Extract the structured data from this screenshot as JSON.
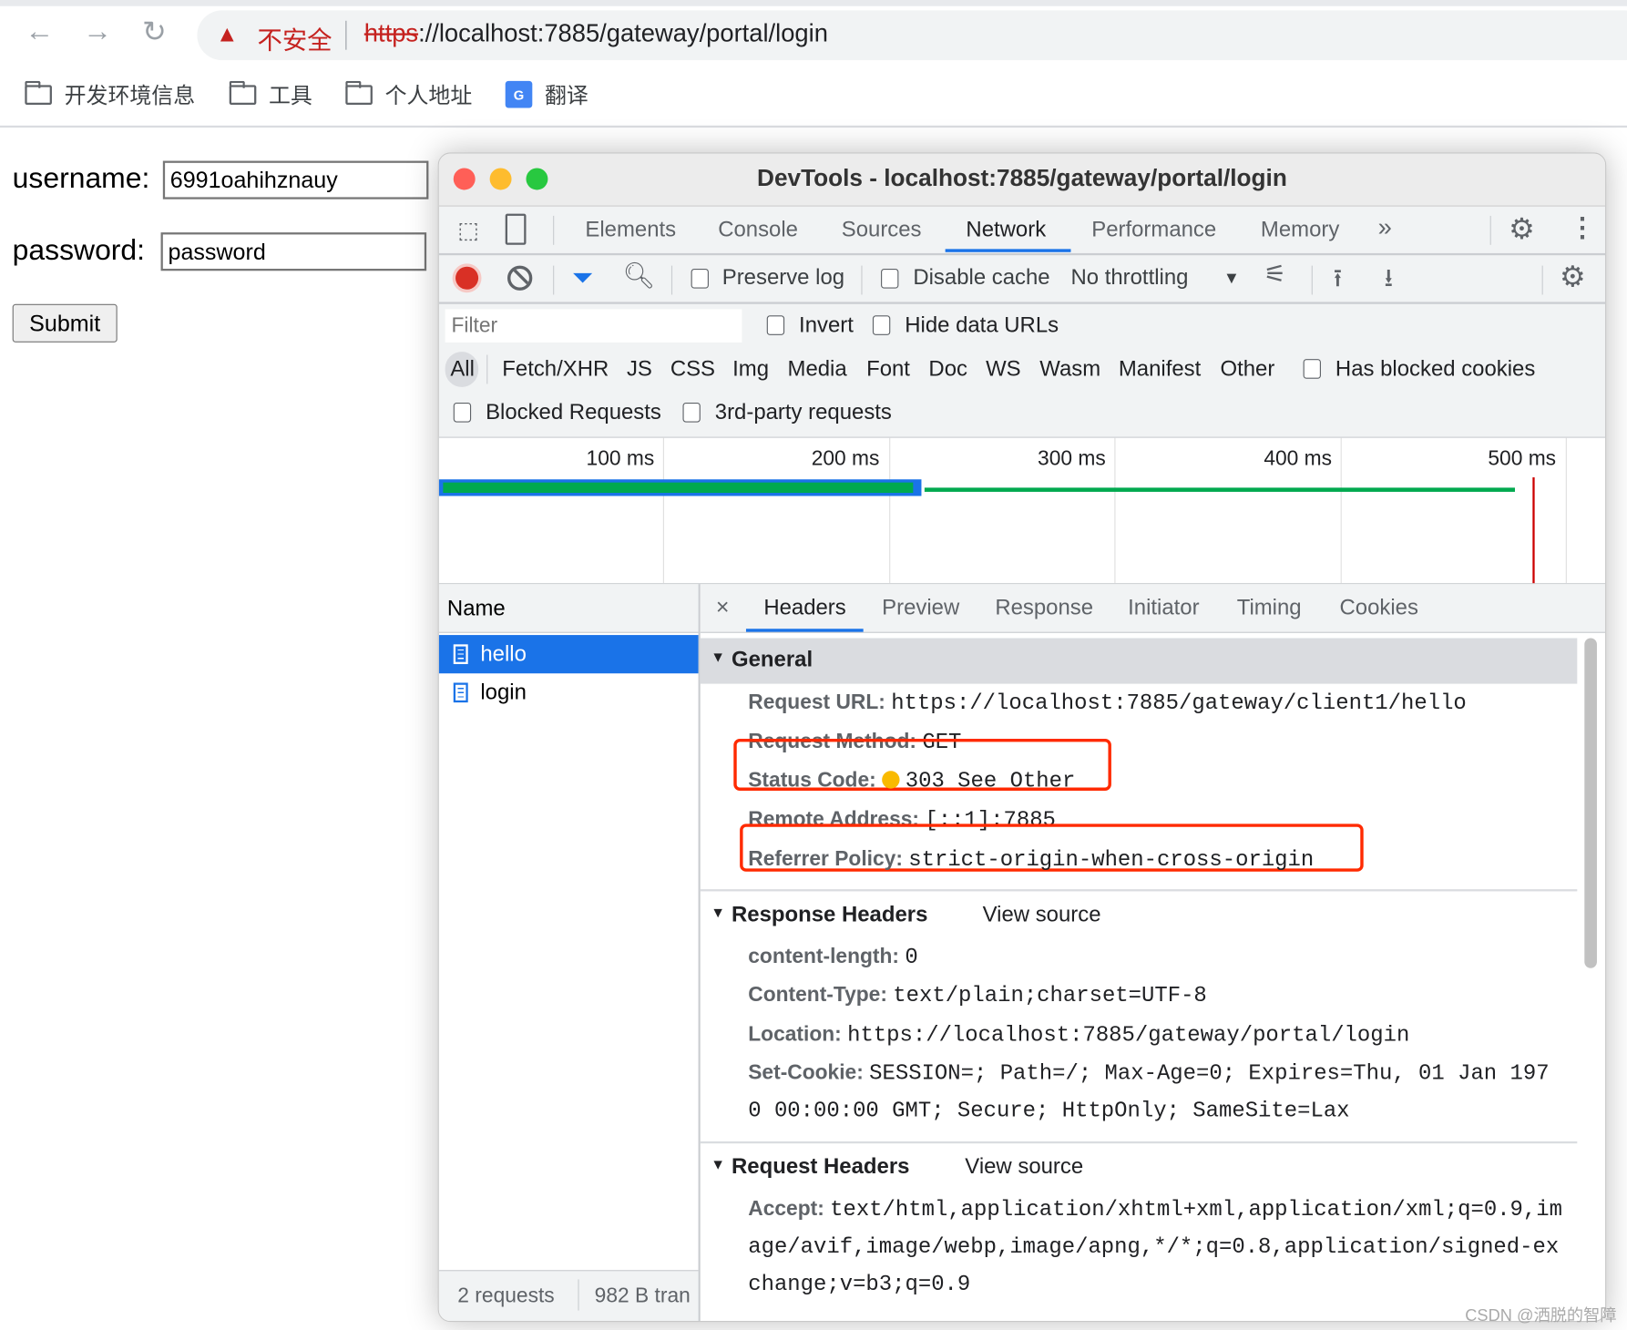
{
  "browser": {
    "security_label": "不安全",
    "url_scheme": "https",
    "url_rest": "://localhost:7885/gateway/portal/login",
    "bookmarks": [
      {
        "icon": "folder-icon",
        "label": "开发环境信息"
      },
      {
        "icon": "folder-icon",
        "label": "工具"
      },
      {
        "icon": "folder-icon",
        "label": "个人地址"
      },
      {
        "icon": "google-translate-icon",
        "label": "翻译"
      }
    ]
  },
  "page": {
    "username_label": "username:",
    "username_value": "6991oahihznauy",
    "password_label": "password:",
    "password_value": "password",
    "submit_label": "Submit"
  },
  "devtools": {
    "title": "DevTools - localhost:7885/gateway/portal/login",
    "tabs": [
      "Elements",
      "Console",
      "Sources",
      "Network",
      "Performance",
      "Memory"
    ],
    "active_tab": "Network",
    "toolbar": {
      "preserve_log": "Preserve log",
      "disable_cache": "Disable cache",
      "throttling": "No throttling"
    },
    "filter": {
      "placeholder": "Filter",
      "invert": "Invert",
      "hide_data_urls": "Hide data URLs",
      "types": [
        "All",
        "Fetch/XHR",
        "JS",
        "CSS",
        "Img",
        "Media",
        "Font",
        "Doc",
        "WS",
        "Wasm",
        "Manifest",
        "Other"
      ],
      "has_blocked_cookies": "Has blocked cookies",
      "blocked_requests": "Blocked Requests",
      "third_party": "3rd-party requests"
    },
    "timeline": {
      "ticks": [
        "100 ms",
        "200 ms",
        "300 ms",
        "400 ms",
        "500 ms"
      ]
    },
    "requests": {
      "header": "Name",
      "items": [
        {
          "name": "hello",
          "selected": true
        },
        {
          "name": "login",
          "selected": false
        }
      ],
      "footer_count": "2 requests",
      "footer_transfer": "982 B tran"
    },
    "detail": {
      "close": "×",
      "tabs": [
        "Headers",
        "Preview",
        "Response",
        "Initiator",
        "Timing",
        "Cookies"
      ],
      "active_tab": "Headers",
      "general": {
        "title": "General",
        "rows": [
          {
            "k": "Request URL:",
            "v": "https://localhost:7885/gateway/client1/hello"
          },
          {
            "k": "Request Method:",
            "v": "GET"
          },
          {
            "k": "Status Code:",
            "v": "303 See Other"
          },
          {
            "k": "Remote Address:",
            "v": "[::1]:7885"
          },
          {
            "k": "Referrer Policy:",
            "v": "strict-origin-when-cross-origin"
          }
        ]
      },
      "response_headers": {
        "title": "Response Headers",
        "view_source": "View source",
        "rows": [
          {
            "k": "content-length:",
            "v": "0"
          },
          {
            "k": "Content-Type:",
            "v": "text/plain;charset=UTF-8"
          },
          {
            "k": "Location:",
            "v": "https://localhost:7885/gateway/portal/login"
          },
          {
            "k": "Set-Cookie:",
            "v": "SESSION=; Path=/; Max-Age=0; Expires=Thu, 01 Jan 197",
            "v2": "0 00:00:00 GMT; Secure; HttpOnly; SameSite=Lax"
          }
        ]
      },
      "request_headers": {
        "title": "Request Headers",
        "view_source": "View source",
        "rows": [
          {
            "k": "Accept:",
            "v": "text/html,application/xhtml+xml,application/xml;q=0.9,im",
            "v2": "age/avif,image/webp,image/apng,*/*;q=0.8,application/signed-ex",
            "v3": "change;v=b3;q=0.9"
          }
        ]
      }
    }
  },
  "watermark": "CSDN @洒脱的智障",
  "colors": {
    "accent": "#1a73e8",
    "insecure": "#c5221f",
    "highlight": "#ff2a00",
    "status_dot": "#f9ba00",
    "timing_bar": "#00a94f"
  }
}
